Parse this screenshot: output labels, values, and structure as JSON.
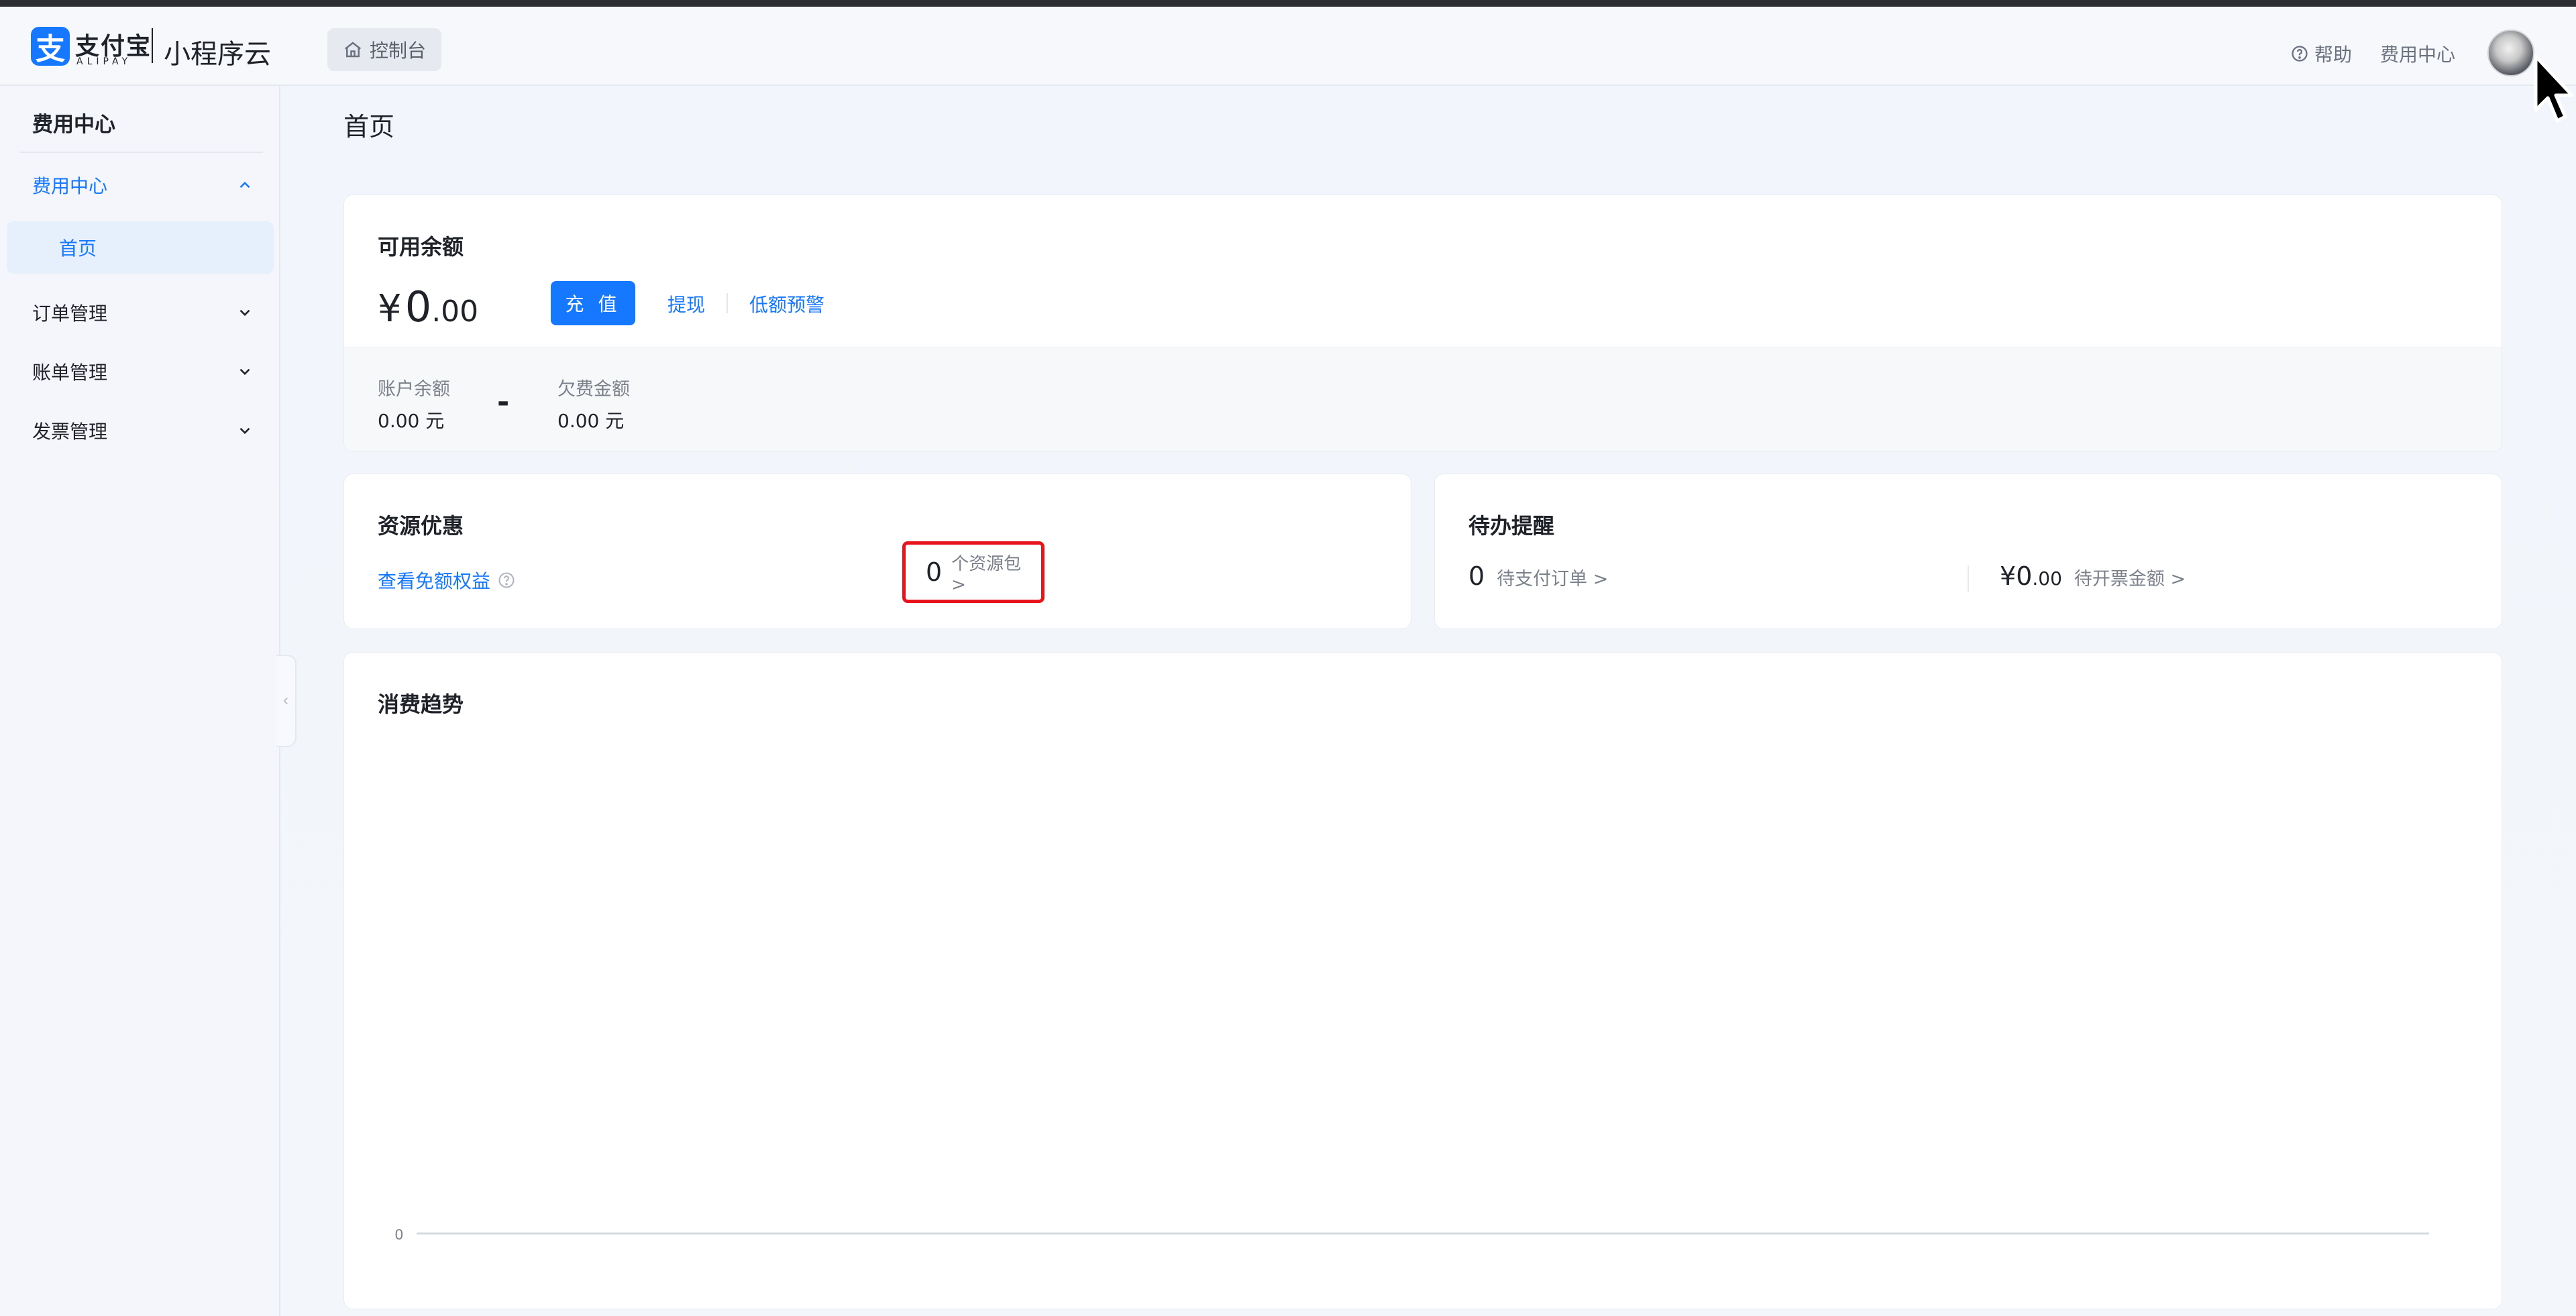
{
  "header": {
    "logo_mark": "支",
    "logo_zh": "支付宝",
    "logo_en": "ALIPAY",
    "product_name": "小程序云",
    "console_label": "控制台",
    "help_label": "帮助",
    "fee_center_label": "费用中心"
  },
  "sidebar": {
    "title": "费用中心",
    "groups": [
      {
        "label": "费用中心",
        "expanded": true,
        "items": [
          {
            "label": "首页",
            "selected": true
          }
        ]
      },
      {
        "label": "订单管理",
        "expanded": false
      },
      {
        "label": "账单管理",
        "expanded": false
      },
      {
        "label": "发票管理",
        "expanded": false
      }
    ]
  },
  "main": {
    "page_title": "首页",
    "balance": {
      "title": "可用余额",
      "currency": "¥",
      "amount_int": "0",
      "amount_dec": ".00",
      "recharge_label": "充 值",
      "withdraw_label": "提现",
      "low_balance_alert_label": "低额预警",
      "account_balance_label": "账户余额",
      "account_balance_value": "0.00 元",
      "minus": "-",
      "arrears_label": "欠费金额",
      "arrears_value": "0.00 元"
    },
    "resources": {
      "title": "资源优惠",
      "free_quota_link": "查看免额权益",
      "package_count": "0",
      "package_label": "个资源包 >"
    },
    "todo": {
      "title": "待办提醒",
      "unpaid_count": "0",
      "unpaid_label": "待支付订单 >",
      "invoice_currency": "¥",
      "invoice_int": "0",
      "invoice_dec": ".00",
      "invoice_label": "待开票金额 >"
    },
    "trend": {
      "title": "消费趋势"
    }
  },
  "chart_data": {
    "type": "line",
    "title": "消费趋势",
    "x": [],
    "series": [],
    "yticks": [
      "0"
    ],
    "ylim": [
      0,
      0
    ],
    "grid": false
  },
  "colors": {
    "accent": "#1677ff",
    "highlight_border": "#e8141b",
    "sidebar_selected_bg": "#e6f0fd"
  }
}
